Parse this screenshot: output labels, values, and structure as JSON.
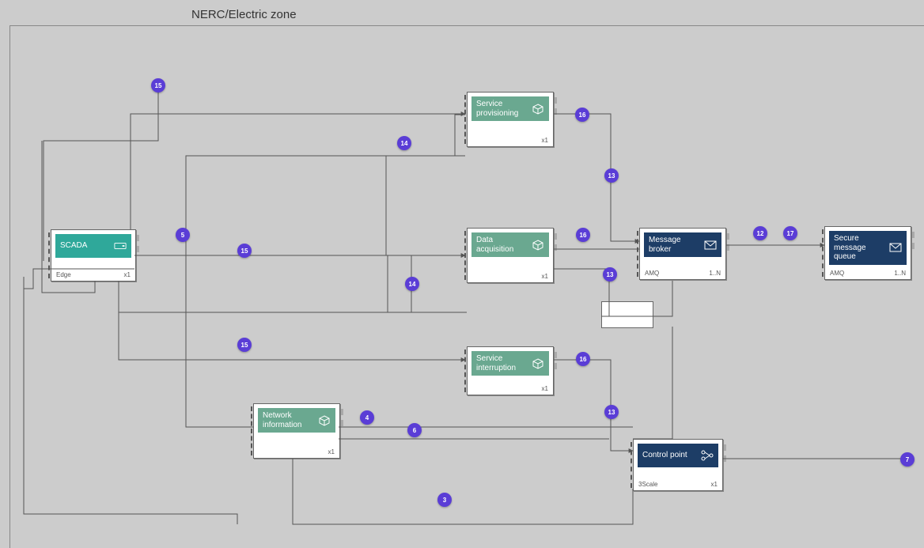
{
  "zone": {
    "title": "NERC/Electric zone"
  },
  "nodes": {
    "scada": {
      "title": "SCADA",
      "sub": "Edge",
      "mult": "x1"
    },
    "service_provisioning": {
      "title": "Service provisioning",
      "sub": "",
      "mult": "x1"
    },
    "data_acquisition": {
      "title": "Data acquisition",
      "sub": "",
      "mult": "x1"
    },
    "service_interruption": {
      "title": "Service interruption",
      "sub": "",
      "mult": "x1"
    },
    "network_information": {
      "title": "Network information",
      "sub": "",
      "mult": "x1"
    },
    "message_broker": {
      "title": "Message broker",
      "sub": "AMQ",
      "mult": "1..N"
    },
    "secure_message_queue": {
      "title": "Secure message queue",
      "sub": "AMQ",
      "mult": "1..N"
    },
    "control_point": {
      "title": "Control point",
      "sub": "3Scale",
      "mult": "x1"
    }
  },
  "badges": {
    "b15a": "15",
    "b14a": "14",
    "b16a": "16",
    "b5": "5",
    "b15b": "15",
    "b13a": "13",
    "b16b": "16",
    "b12": "12",
    "b17": "17",
    "b14b": "14",
    "b13b": "13",
    "b15c": "15",
    "b16c": "16",
    "b13c": "13",
    "b4": "4",
    "b6": "6",
    "b3": "3",
    "b7": "7"
  }
}
